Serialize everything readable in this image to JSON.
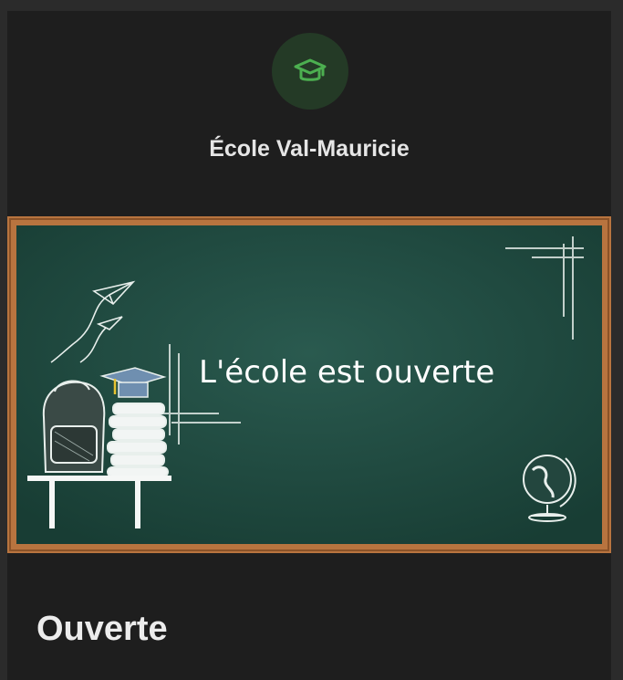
{
  "school": {
    "name": "École Val-Mauricie",
    "logo_icon": "graduation-cap-icon",
    "accent_color": "#4caf50"
  },
  "banner": {
    "text": "L'école est ouverte",
    "board_color": "#1e4a40",
    "frame_color": "#b8743f"
  },
  "status": {
    "label": "Ouverte"
  }
}
